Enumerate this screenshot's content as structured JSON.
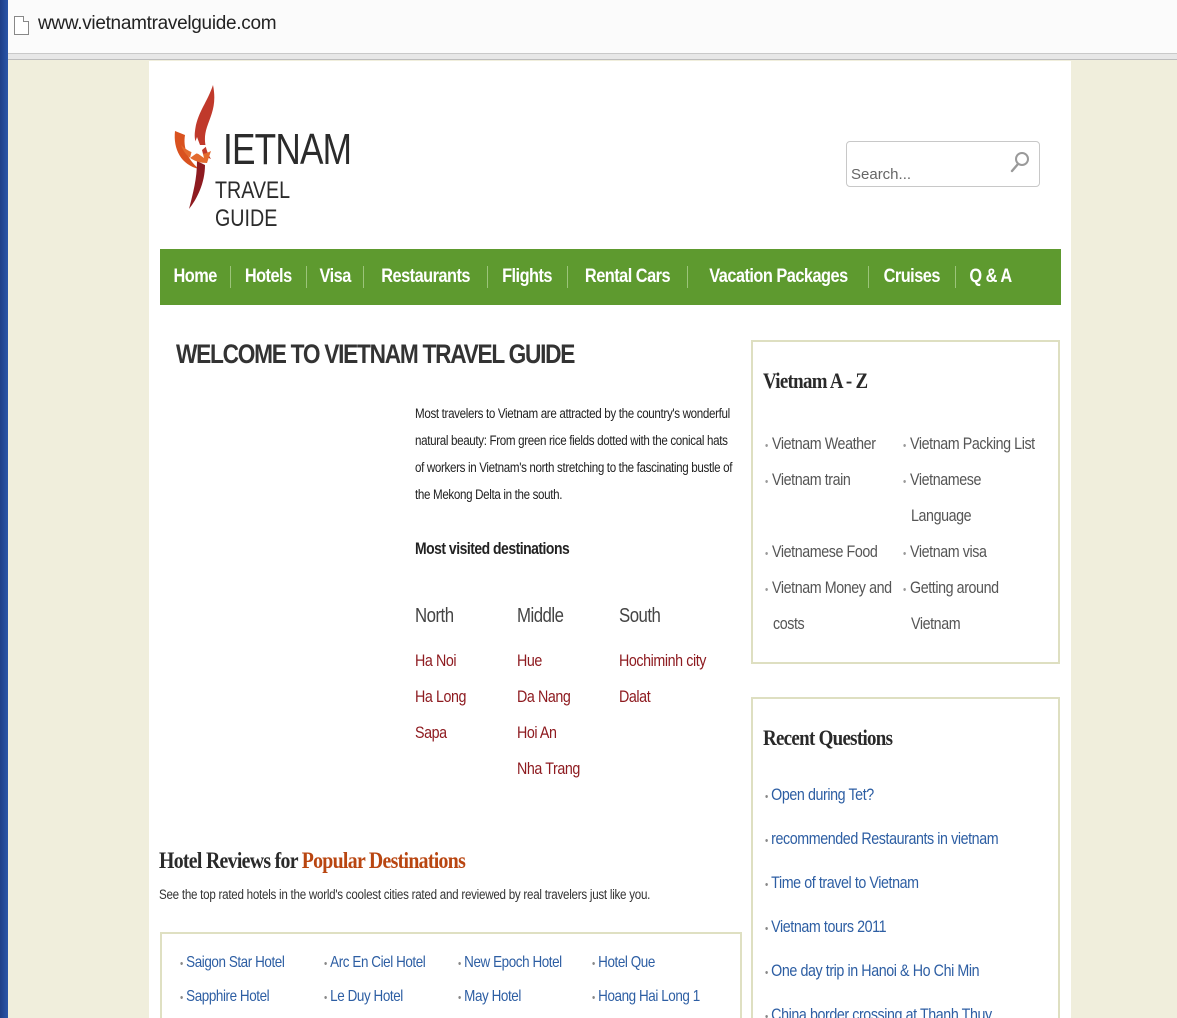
{
  "browser": {
    "url": "www.vietnamtravelguide.com"
  },
  "logo": {
    "word": "IETNAM",
    "sub": "TRAVEL GUIDE",
    "brand_color": "#c0392b"
  },
  "search": {
    "placeholder": "Search..."
  },
  "nav": {
    "color": "#5e9a2f",
    "items": [
      "Home",
      "Hotels",
      "Visa",
      "Restaurants",
      "Flights",
      "Rental Cars",
      "Vacation Packages",
      "Cruises",
      "Q & A"
    ]
  },
  "welcome": {
    "title": "WELCOME TO VIETNAM TRAVEL GUIDE",
    "intro": "Most travelers to Vietnam are attracted by the country's wonderful natural beauty: From green rice fields dotted with the conical hats of workers in Vietnam's north stretching to the fascinating bustle of the Mekong Delta in the south.",
    "most_visited_label": "Most visited destinations"
  },
  "destinations": {
    "columns": [
      {
        "heading": "North",
        "items": [
          "Ha Noi",
          "Ha Long",
          "Sapa"
        ]
      },
      {
        "heading": "Middle",
        "items": [
          "Hue",
          "Da Nang",
          "Hoi An",
          "Nha Trang"
        ]
      },
      {
        "heading": "South",
        "items": [
          "Hochiminh city",
          "Dalat"
        ]
      }
    ]
  },
  "hotel_reviews": {
    "title_plain": "Hotel Reviews for ",
    "title_accent": "Popular Destinations",
    "subtitle": "See the top rated hotels in the world's coolest cities rated and reviewed by real travelers just like you.",
    "hotels": [
      "Saigon Star Hotel",
      "Arc En Ciel Hotel",
      "New Epoch Hotel",
      "Hotel Que",
      "Sapphire Hotel",
      "Le Duy Hotel",
      "May Hotel",
      "Hoang Hai Long 1"
    ]
  },
  "sidebar": {
    "az": {
      "title": "Vietnam A - Z",
      "items": [
        "Vietnam Weather",
        "Vietnam Packing List",
        "Vietnam train",
        "Vietnamese",
        "Language",
        "Vietnamese Food",
        "Vietnam visa",
        "Vietnam Money and",
        "costs",
        "Getting around",
        "Vietnam"
      ]
    },
    "recent": {
      "title": "Recent Questions",
      "items": [
        "Open during Tet?",
        "recommended Restaurants in vietnam",
        "Time of travel to Vietnam",
        "Vietnam tours 2011",
        "One day trip in Hanoi & Ho Chi Min",
        "China border crossing at Thanh Thuy"
      ]
    }
  }
}
